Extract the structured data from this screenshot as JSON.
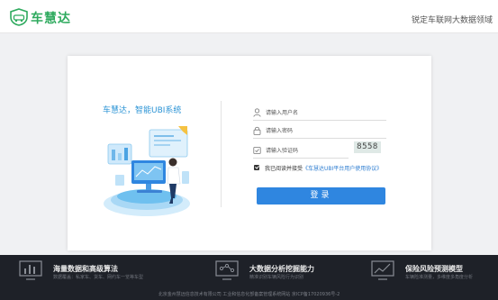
{
  "header": {
    "brand": "车慧达",
    "slogan": "锐定车联网大数据领域"
  },
  "login": {
    "tagline": "车慧达，智能UBI系统",
    "username_placeholder": "请输入用户名",
    "password_placeholder": "请输入密码",
    "captcha_placeholder": "请输入验证码",
    "captcha_code": "8558",
    "agree_prefix": "我已阅读并接受",
    "agree_link": "《车慧达UBI平台用户使用协议》",
    "agree_checked": true,
    "login_label": "登录"
  },
  "footer": {
    "features": [
      {
        "icon": "bar-chart-icon",
        "title": "海量数据和高级算法",
        "desc": "数据覆盖：私家车、货车、网约车一览等车型"
      },
      {
        "icon": "network-analysis-icon",
        "title": "大数据分析挖掘能力",
        "desc": "精准识别车辆风险行为识别"
      },
      {
        "icon": "trend-chart-icon",
        "title": "保险风险预测模型",
        "desc": "车辆险准测量，多维度多角度分析"
      }
    ],
    "copyright": "北京金州慧远信息技术有限公司    工业和信息化部备案管理系统网站 京ICP备17020936号-2"
  },
  "colors": {
    "brand_green": "#2eaa5e",
    "accent_blue": "#2f86e0",
    "footer_bg": "#1e2128"
  }
}
